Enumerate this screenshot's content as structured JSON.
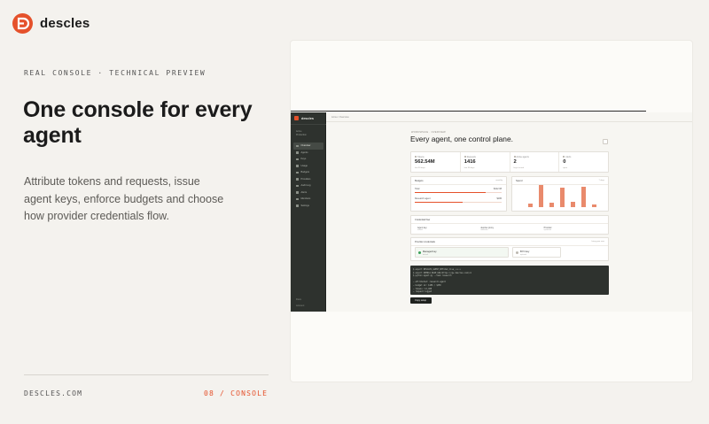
{
  "brand": {
    "name": "descles",
    "color": "#e5512b",
    "icon": "descles-logo-icon"
  },
  "eyebrow": "REAL CONSOLE · TECHNICAL PREVIEW",
  "headline": "One console for every agent",
  "description": "Attribute tokens and requests, issue agent keys, enforce budgets and choose how provider credentials flow.",
  "footer": {
    "site": "DESCLES.COM",
    "section": "08 / CONSOLE"
  },
  "console": {
    "brand": "descles",
    "workspace": [
      "Acme",
      "Production"
    ],
    "nav": [
      "Overview",
      "Agents",
      "Keys",
      "Usage",
      "Budgets",
      "Providers",
      "Audit Log",
      "Alerts",
      "Members",
      "Settings"
    ],
    "active_nav": "Overview",
    "nav_footer": [
      "Docs",
      "Account"
    ],
    "breadcrumb": "Acme / Overview",
    "overview_label": "WORKSPACE · OVERVIEW",
    "title": "Every agent, one control plane.",
    "stats": [
      {
        "label": "Tokens",
        "value": "562.54M",
        "sub": "last 30 days"
      },
      {
        "label": "Requests",
        "value": "1416",
        "sub": "last 30 days"
      },
      {
        "label": "Active agents",
        "value": "2",
        "sub": "keys issued"
      },
      {
        "label": "Alerts",
        "value": "0",
        "sub": "open"
      }
    ],
    "budget_panel": {
      "title": "Budgets",
      "meta": "monthly",
      "rows": [
        {
          "name": "Total",
          "value": "$412.08",
          "fraction": 0.82
        },
        {
          "name": "Research agent",
          "value": "$186",
          "fraction": 0.55
        }
      ]
    },
    "spend_panel": {
      "title": "Spend",
      "meta": "7 days",
      "bars": [
        0.15,
        0.95,
        0.2,
        0.85,
        0.25,
        0.9,
        0.1
      ]
    },
    "flow_panel": {
      "title": "Credential flow",
      "meta": "",
      "steps": [
        {
          "name": "Agent key",
          "sub": "issued"
        },
        {
          "name": "descles proxy",
          "sub": "attributes"
        },
        {
          "name": "Provider",
          "sub": "upstream"
        }
      ]
    },
    "cred_panel": {
      "title": "Provider credentials",
      "meta": "bring your own",
      "items": [
        {
          "name": "Managed key",
          "sub": "default",
          "color": "#3aa05a"
        },
        {
          "name": "BYO key",
          "sub": "optional",
          "color": "#bcb8b0"
        }
      ]
    },
    "terminal": [
      "$ export DESCLES_AGENT_KEY=dsk_live_•••••",
      "$ export OPENAI_BASE_URL=https://gw.descles.com/v1",
      "$ python agent.py --task research",
      "",
      "→ attributed: research-agent",
      "→ budget ok: $186 / $250",
      "→ tokens: 12,408",
      "→ request logged"
    ],
    "copy_label": "Copy setup"
  }
}
